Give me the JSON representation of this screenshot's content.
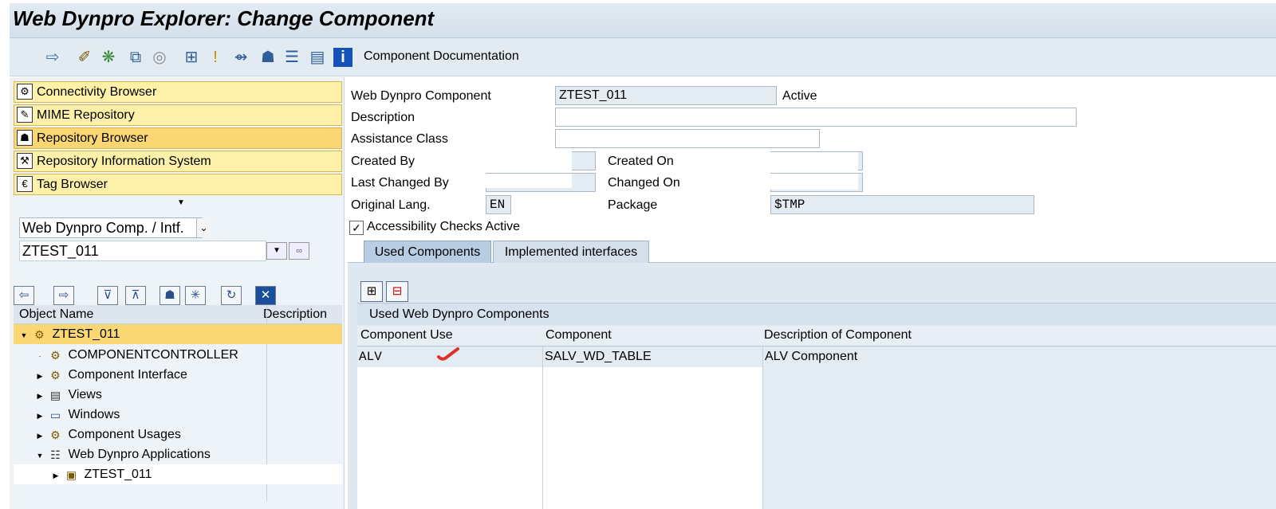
{
  "title": "Web Dynpro Explorer: Change Component",
  "toolbar": {
    "icons": [
      "forward-arrow-icon",
      "magic-wand-icon",
      "network-icon",
      "hierarchy-icon",
      "spiral-icon",
      "tree-icon",
      "pin-icon",
      "flow-icon",
      "org-icon",
      "stack-icon",
      "list-icon",
      "info-icon"
    ],
    "doc_label": "Component Documentation"
  },
  "nav": {
    "items": [
      {
        "label": "Connectivity Browser",
        "icon": "connectivity-icon"
      },
      {
        "label": "MIME Repository",
        "icon": "mime-icon"
      },
      {
        "label": "Repository Browser",
        "icon": "repository-icon"
      },
      {
        "label": "Repository Information System",
        "icon": "info-system-icon"
      },
      {
        "label": "Tag Browser",
        "icon": "tag-icon"
      }
    ],
    "object_type": "Web Dynpro Comp. / Intf.",
    "object_name": "ZTEST_011"
  },
  "tree": {
    "col_object": "Object Name",
    "col_desc": "Description",
    "rows": [
      {
        "label": "ZTEST_011"
      },
      {
        "label": "COMPONENTCONTROLLER"
      },
      {
        "label": "Component Interface"
      },
      {
        "label": "Views"
      },
      {
        "label": "Windows"
      },
      {
        "label": "Component Usages"
      },
      {
        "label": "Web Dynpro Applications"
      },
      {
        "label": "ZTEST_011"
      }
    ]
  },
  "form": {
    "component_label": "Web Dynpro Component",
    "component_value": "ZTEST_011",
    "status": "Active",
    "description_label": "Description",
    "description_value": "",
    "assistance_label": "Assistance Class",
    "assistance_value": "",
    "created_by_label": "Created By",
    "created_by_value": "",
    "created_on_label": "Created On",
    "created_on_value": "",
    "last_changed_by_label": "Last Changed By",
    "last_changed_by_value": "",
    "changed_on_label": "Changed On",
    "changed_on_value": "",
    "orig_lang_label": "Original Lang.",
    "orig_lang_value": "EN",
    "package_label": "Package",
    "package_value": "$TMP",
    "accessibility_label": "Accessibility Checks Active",
    "accessibility_checked": true
  },
  "tabs": [
    {
      "label": "Used Components",
      "active": true
    },
    {
      "label": "Implemented interfaces",
      "active": false
    }
  ],
  "table": {
    "title": "Used Web Dynpro Components",
    "columns": [
      "Component Use",
      "Component",
      "Description of Component"
    ],
    "rows": [
      {
        "use": "ALV",
        "component": "SALV_WD_TABLE",
        "description": "ALV Component"
      }
    ]
  }
}
